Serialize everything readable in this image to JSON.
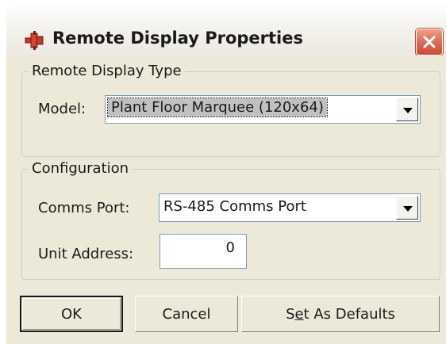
{
  "window": {
    "title": "Remote Display Properties",
    "app_icon": "plugin-icon",
    "close_icon": "close-icon"
  },
  "remote_display_type": {
    "group_label": "Remote Display Type",
    "model_label": "Model:",
    "model_value": "Plant Floor Marquee (120x64)"
  },
  "configuration": {
    "group_label": "Configuration",
    "comms_port_label": "Comms Port:",
    "comms_port_value": "RS-485 Comms Port",
    "unit_address_label": "Unit Address:",
    "unit_address_value": "0"
  },
  "buttons": {
    "ok": "OK",
    "cancel": "Cancel",
    "set_defaults_prefix": "S",
    "set_defaults_mnemonic": "e",
    "set_defaults_suffix": "t As Defaults"
  },
  "colors": {
    "dialog_bg": "#ece9d8",
    "close_button": "#e0705a",
    "input_border": "#7f9db9"
  }
}
